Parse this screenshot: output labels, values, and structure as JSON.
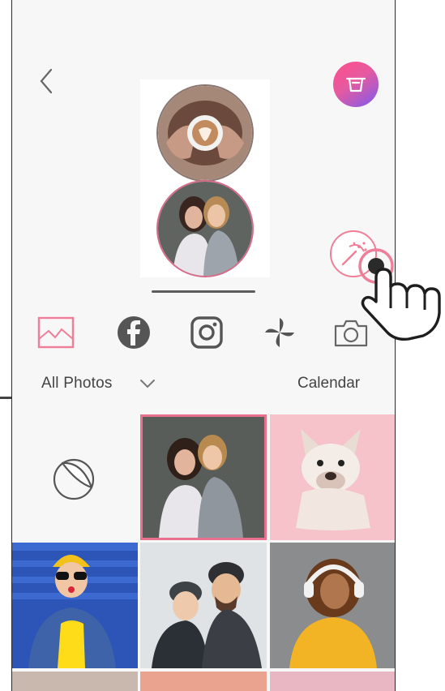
{
  "header": {
    "back_icon": "chevron-left-icon",
    "store_icon": "cart-icon",
    "store_colors": [
      "#ff4f8a",
      "#7b5cf0"
    ]
  },
  "preview": {
    "slots": [
      {
        "name": "coffee-latte-art-photo"
      },
      {
        "name": "two-friends-hugging-photo"
      }
    ]
  },
  "actions": {
    "sticker_icon": "sticker-wand-icon",
    "pointer_icon": "hand-pointer-icon"
  },
  "sources": [
    {
      "name": "gallery",
      "icon": "gallery-icon",
      "selected": true
    },
    {
      "name": "facebook",
      "icon": "facebook-icon",
      "selected": false
    },
    {
      "name": "instagram",
      "icon": "instagram-icon",
      "selected": false
    },
    {
      "name": "pinwheel",
      "icon": "pinwheel-icon",
      "selected": false
    },
    {
      "name": "camera",
      "icon": "camera-icon",
      "selected": false
    }
  ],
  "album": {
    "label": "All Photos",
    "calendar_label": "Calendar"
  },
  "grid": {
    "items": [
      {
        "name": "sticker-cell",
        "icon": "sticker-icon"
      },
      {
        "name": "friends-hugging-photo",
        "selected": true
      },
      {
        "name": "french-bulldog-photo"
      },
      {
        "name": "woman-yellow-beanie-photo"
      },
      {
        "name": "couple-winter-photo"
      },
      {
        "name": "woman-headphones-photo"
      }
    ]
  },
  "accent_color": "#e8708c"
}
